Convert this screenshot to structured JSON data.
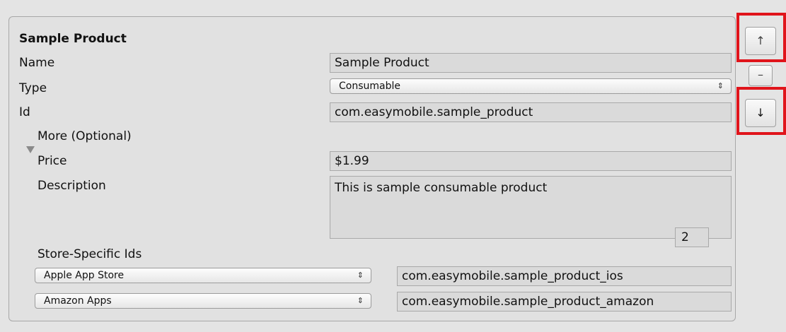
{
  "product": {
    "title": "Sample Product",
    "name_label": "Name",
    "name_value": "Sample Product",
    "type_label": "Type",
    "type_value": "Consumable",
    "id_label": "Id",
    "id_value": "com.easymobile.sample_product",
    "more_label": "More (Optional)",
    "price_label": "Price",
    "price_value": "$1.99",
    "description_label": "Description",
    "description_value": "This is sample consumable product",
    "store_ids_label": "Store-Specific Ids",
    "store_ids_count": "2",
    "stores": [
      {
        "store": "Apple App Store",
        "id": "com.easymobile.sample_product_ios"
      },
      {
        "store": "Amazon Apps",
        "id": "com.easymobile.sample_product_amazon"
      }
    ]
  },
  "side_buttons": {
    "up": "↑",
    "remove": "–",
    "down": "↓"
  },
  "dropdown_arrows": "⇕",
  "colors": {
    "highlight": "#e0141b",
    "panel_bg": "#e1e1e1",
    "field_bg": "#dadada"
  }
}
